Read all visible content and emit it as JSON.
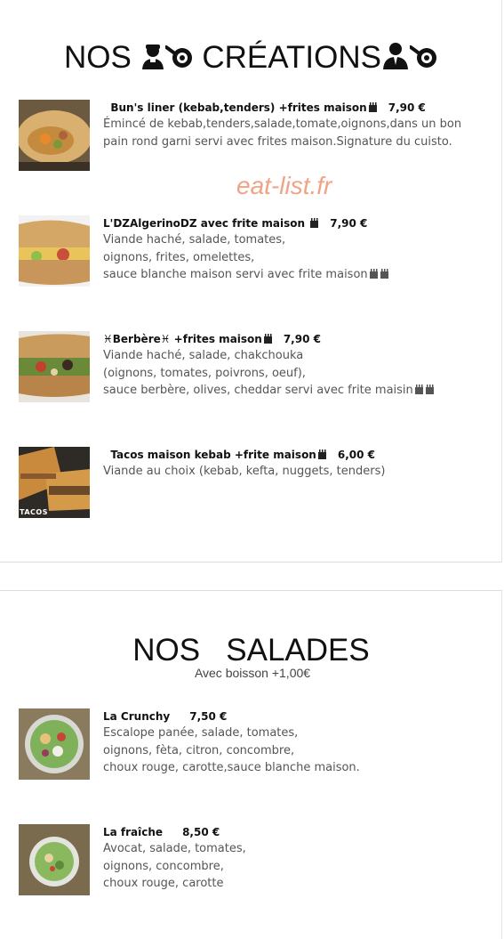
{
  "sections": [
    {
      "title_part1": "NOS",
      "title_part2": "CRÉATIONS",
      "icons": [
        "chef-icon",
        "frying-pan-icon",
        "person-icon",
        "frying-pan-icon"
      ],
      "items": [
        {
          "name": "Bun's liner  (kebab,tenders) +frites maison",
          "price": "7,90 €",
          "desc": [
            "Émincé de kebab,tenders,salade,tomate,oignons,dans un bon",
            "pain rond garni servi avec frites maison.Signature du cuisto."
          ]
        },
        {
          "name": "L'DZAlgerinoDZ avec frite maison",
          "price": "7,90 €",
          "desc": [
            "Viande haché, salade, tomates,",
            "oignons, frites, omelettes,",
            "sauce blanche maison servi avec frite maison"
          ]
        },
        {
          "name": "♓Berbère♓ +frites maison",
          "price": "7,90 €",
          "desc": [
            "Viande haché, salade, chakchouka",
            "(oignons, tomates, poivrons, oeuf),",
            "sauce berbère, olives, cheddar servi avec frite maisin"
          ]
        },
        {
          "name": "Tacos maison  kebab +frite maison",
          "price": "6,00 €",
          "desc": [
            "Viande au choix (kebab, kefta, nuggets, tenders)"
          ],
          "image_caption": "TACOS"
        }
      ]
    },
    {
      "title_part1": "NOS",
      "title_part2": "SALADES",
      "subtitle": "Avec boisson +1,00€",
      "items": [
        {
          "name": "La  Crunchy",
          "price": "7,50 €",
          "desc": [
            "Escalope panée, salade, tomates,",
            "oignons, fèta, citron, concombre,",
            "choux rouge, carotte,sauce blanche maison."
          ]
        },
        {
          "name": "La  fraîche",
          "price": "8,50 €",
          "desc": [
            "Avocat, salade, tomates,",
            "oignons, concombre,",
            "choux rouge, carotte"
          ]
        }
      ]
    }
  ],
  "watermark": "eat-list.fr",
  "colors": {
    "title": "#111111",
    "text": "#555555",
    "watermark": "#f0a385"
  }
}
